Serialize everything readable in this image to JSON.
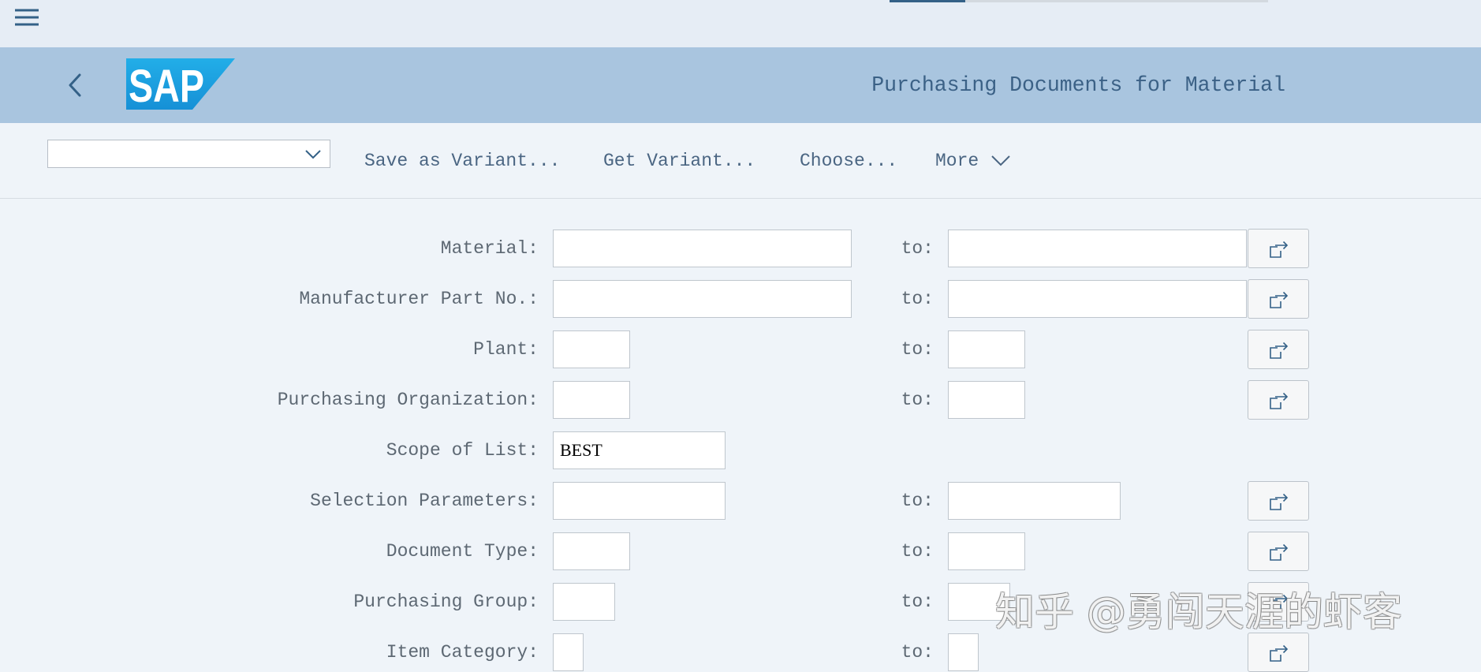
{
  "top_bar": {
    "menu_icon": "hamburger-menu-icon",
    "progress": 0.2
  },
  "header": {
    "back_icon": "back-chevron-icon",
    "logo_text": "SAP",
    "title": "Purchasing Documents for Material"
  },
  "toolbar": {
    "variant_select_value": "",
    "save_as_variant": "Save as Variant...",
    "get_variant": "Get Variant...",
    "choose": "Choose...",
    "more": "More"
  },
  "form": {
    "to_label": "to:",
    "fields": [
      {
        "label": "Material:",
        "from_value": "",
        "to_value": ""
      },
      {
        "label": "Manufacturer Part No.:",
        "from_value": "",
        "to_value": ""
      },
      {
        "label": "Plant:",
        "from_value": "",
        "to_value": ""
      },
      {
        "label": "Purchasing Organization:",
        "from_value": "",
        "to_value": ""
      },
      {
        "label": "Scope of List:",
        "from_value": "BEST"
      },
      {
        "label": "Selection Parameters:",
        "from_value": "",
        "to_value": ""
      },
      {
        "label": "Document Type:",
        "from_value": "",
        "to_value": ""
      },
      {
        "label": "Purchasing Group:",
        "from_value": "",
        "to_value": ""
      },
      {
        "label": "Item Category:",
        "from_value": "",
        "to_value": ""
      }
    ]
  },
  "watermark": "知乎 @勇闯天涯的虾客",
  "colors": {
    "accent": "#346187",
    "shell_header": "#a9c5df",
    "logo_blue": "#1ea1e2",
    "background": "#eff4f9"
  }
}
